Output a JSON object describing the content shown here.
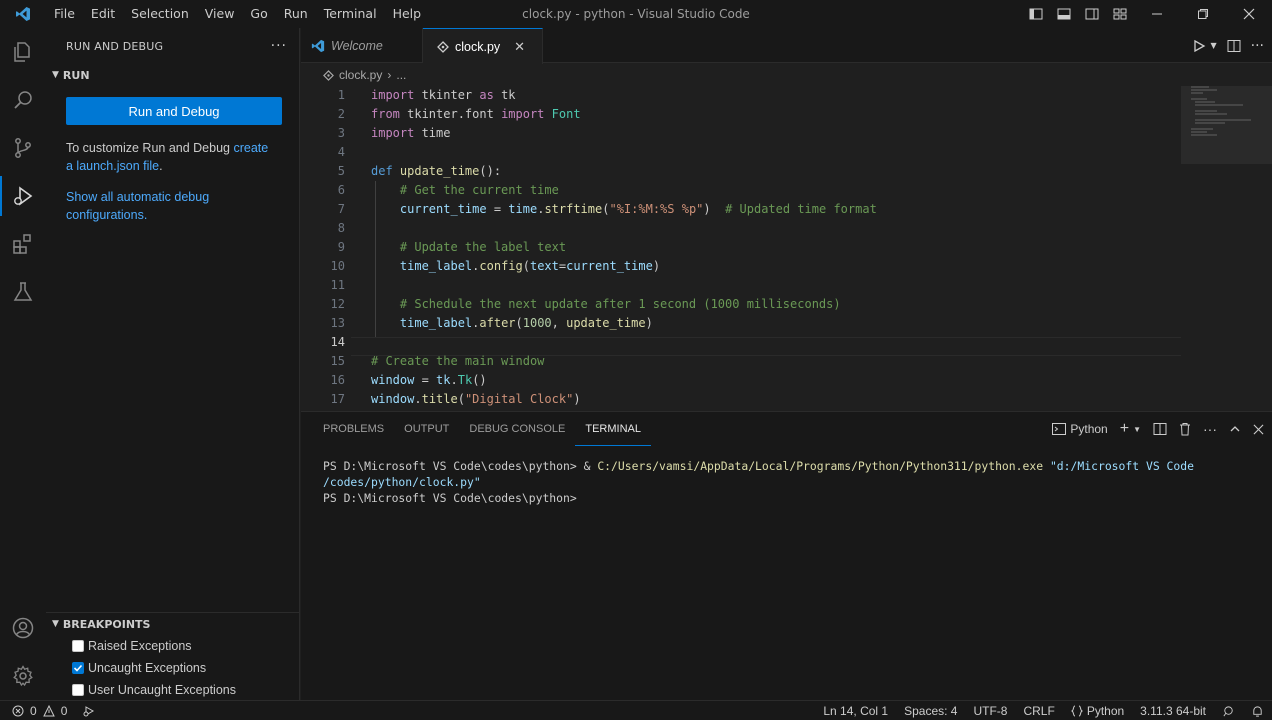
{
  "window": {
    "title": "clock.py - python - Visual Studio Code"
  },
  "menu": [
    "File",
    "Edit",
    "Selection",
    "View",
    "Go",
    "Run",
    "Terminal",
    "Help"
  ],
  "sidebar": {
    "header": "RUN AND DEBUG",
    "run_section": "RUN",
    "run_button": "Run and Debug",
    "help_prefix": "To customize Run and Debug ",
    "help_link1": "create",
    "help_link2": "a launch.json file",
    "help_suffix": ".",
    "show_link": "Show all automatic debug configurations.",
    "breakpoints_header": "BREAKPOINTS",
    "breakpoints": [
      {
        "label": "Raised Exceptions",
        "checked": false
      },
      {
        "label": "Uncaught Exceptions",
        "checked": true
      },
      {
        "label": "User Uncaught Exceptions",
        "checked": false
      }
    ]
  },
  "tabs": [
    {
      "label": "Welcome",
      "active": false
    },
    {
      "label": "clock.py",
      "active": true
    }
  ],
  "breadcrumb": {
    "file": "clock.py",
    "rest": "..."
  },
  "editor": {
    "current_line": 14,
    "lines": [
      {
        "n": "1",
        "tokens": [
          [
            "kw",
            "import"
          ],
          [
            "",
            " tkinter "
          ],
          [
            "kw",
            "as"
          ],
          [
            "",
            " tk"
          ]
        ]
      },
      {
        "n": "2",
        "tokens": [
          [
            "kw",
            "from"
          ],
          [
            "",
            " tkinter.font "
          ],
          [
            "kw",
            "import"
          ],
          [
            "cls",
            " Font"
          ]
        ]
      },
      {
        "n": "3",
        "tokens": [
          [
            "kw",
            "import"
          ],
          [
            "",
            " time"
          ]
        ]
      },
      {
        "n": "4",
        "tokens": []
      },
      {
        "n": "5",
        "tokens": [
          [
            "kw2",
            "def"
          ],
          [
            "fn",
            " update_time"
          ],
          [
            "",
            "():"
          ]
        ]
      },
      {
        "n": "6",
        "tokens": [
          [
            "",
            "    "
          ],
          [
            "cm",
            "# Get the current time"
          ]
        ]
      },
      {
        "n": "7",
        "tokens": [
          [
            "",
            "    "
          ],
          [
            "var",
            "current_time"
          ],
          [
            "",
            " = "
          ],
          [
            "var",
            "time"
          ],
          [
            "",
            "."
          ],
          [
            "fn",
            "strftime"
          ],
          [
            "",
            "("
          ],
          [
            "str",
            "\"%I:%M:%S %p\""
          ],
          [
            "",
            ")  "
          ],
          [
            "cm",
            "# Updated time format"
          ]
        ]
      },
      {
        "n": "8",
        "tokens": []
      },
      {
        "n": "9",
        "tokens": [
          [
            "",
            "    "
          ],
          [
            "cm",
            "# Update the label text"
          ]
        ]
      },
      {
        "n": "10",
        "tokens": [
          [
            "",
            "    "
          ],
          [
            "var",
            "time_label"
          ],
          [
            "",
            "."
          ],
          [
            "fn",
            "config"
          ],
          [
            "",
            "("
          ],
          [
            "var",
            "text"
          ],
          [
            "",
            "="
          ],
          [
            "var",
            "current_time"
          ],
          [
            "",
            ")"
          ]
        ]
      },
      {
        "n": "11",
        "tokens": []
      },
      {
        "n": "12",
        "tokens": [
          [
            "",
            "    "
          ],
          [
            "cm",
            "# Schedule the next update after 1 second (1000 milliseconds)"
          ]
        ]
      },
      {
        "n": "13",
        "tokens": [
          [
            "",
            "    "
          ],
          [
            "var",
            "time_label"
          ],
          [
            "",
            "."
          ],
          [
            "fn",
            "after"
          ],
          [
            "",
            "("
          ],
          [
            "num",
            "1000"
          ],
          [
            "",
            ", "
          ],
          [
            "fn",
            "update_time"
          ],
          [
            "",
            ")"
          ]
        ]
      },
      {
        "n": "14",
        "tokens": []
      },
      {
        "n": "15",
        "tokens": [
          [
            "cm",
            "# Create the main window"
          ]
        ]
      },
      {
        "n": "16",
        "tokens": [
          [
            "var",
            "window"
          ],
          [
            "",
            " = "
          ],
          [
            "var",
            "tk"
          ],
          [
            "",
            "."
          ],
          [
            "cls",
            "Tk"
          ],
          [
            "",
            "()"
          ]
        ]
      },
      {
        "n": "17",
        "tokens": [
          [
            "var",
            "window"
          ],
          [
            "",
            "."
          ],
          [
            "fn",
            "title"
          ],
          [
            "",
            "("
          ],
          [
            "str",
            "\"Digital Clock\""
          ],
          [
            "",
            ")"
          ]
        ]
      }
    ]
  },
  "panel": {
    "tabs": [
      {
        "label": "PROBLEMS",
        "active": false
      },
      {
        "label": "OUTPUT",
        "active": false
      },
      {
        "label": "DEBUG CONSOLE",
        "active": false
      },
      {
        "label": "TERMINAL",
        "active": true
      }
    ],
    "terminal_name": "Python",
    "terminal": {
      "prompt1": "PS D:\\Microsoft VS Code\\codes\\python> ",
      "amp": "& ",
      "exe": "C:/Users/vamsi/AppData/Local/Programs/Python/Python311/python.exe",
      "arg1": " \"d:/Microsoft VS Code",
      "arg2": "/codes/python/clock.py\"",
      "prompt2": "PS D:\\Microsoft VS Code\\codes\\python> "
    }
  },
  "status": {
    "errors": "0",
    "warnings": "0",
    "position": "Ln 14, Col 1",
    "spaces": "Spaces: 4",
    "encoding": "UTF-8",
    "eol": "CRLF",
    "language": "Python",
    "interpreter": "3.11.3 64-bit"
  },
  "colors": {
    "accent": "#0078d4",
    "link": "#4daafc"
  }
}
